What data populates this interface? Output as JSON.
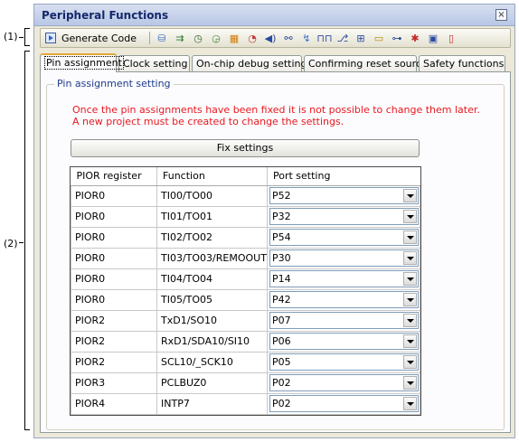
{
  "callouts": {
    "one": "(1)",
    "two": "(2)"
  },
  "window": {
    "title": "Peripheral Functions",
    "close_glyph": "×"
  },
  "toolbar": {
    "generate_label": "Generate Code",
    "icons": [
      {
        "name": "clock-icon",
        "glyph": "⛁",
        "color": "#3a6fc4"
      },
      {
        "name": "port-icon",
        "glyph": "⇉",
        "color": "#2a7a2a"
      },
      {
        "name": "timer-icon",
        "glyph": "◷",
        "color": "#2d6a2d"
      },
      {
        "name": "watchdog-icon",
        "glyph": "◶",
        "color": "#3a8a3a"
      },
      {
        "name": "adc-icon",
        "glyph": "▦",
        "color": "#d07c0c"
      },
      {
        "name": "rtc-icon",
        "glyph": "◔",
        "color": "#c43a3a"
      },
      {
        "name": "sound-icon",
        "glyph": "◀)",
        "color": "#2a4aa0"
      },
      {
        "name": "serial-icon",
        "glyph": "⚯",
        "color": "#2a4aa0"
      },
      {
        "name": "interrupt-icon",
        "glyph": "↯",
        "color": "#3a6fc4"
      },
      {
        "name": "pwm-icon",
        "glyph": "⊓⊓",
        "color": "#2a4aa0"
      },
      {
        "name": "dma-icon",
        "glyph": "⎇",
        "color": "#2a4aa0"
      },
      {
        "name": "mux-icon",
        "glyph": "⊞",
        "color": "#2a4aa0"
      },
      {
        "name": "ram-icon",
        "glyph": "▭",
        "color": "#b88a00"
      },
      {
        "name": "network-icon",
        "glyph": "⊶",
        "color": "#2a4aa0"
      },
      {
        "name": "reset-icon",
        "glyph": "✱",
        "color": "#c42a2a"
      },
      {
        "name": "chip-icon",
        "glyph": "▣",
        "color": "#2a4aa0"
      },
      {
        "name": "battery-icon",
        "glyph": "▯",
        "color": "#c42a2a"
      }
    ]
  },
  "tabs": [
    {
      "label": "Pin assignment",
      "active": true
    },
    {
      "label": "Clock setting",
      "active": false
    },
    {
      "label": "On-chip debug setting",
      "active": false
    },
    {
      "label": "Confirming reset source",
      "active": false
    },
    {
      "label": "Safety functions",
      "active": false
    }
  ],
  "panel": {
    "group_label": "Pin assignment setting",
    "warning_line1": "Once the pin assignments have been fixed it is not possible to change them later.",
    "warning_line2": "A new project must be created to change the settings.",
    "fix_button": "Fix settings"
  },
  "table": {
    "headers": [
      "PIOR register",
      "Function",
      "Port setting"
    ],
    "rows": [
      {
        "register": "PIOR0",
        "function": "TI00/TO00",
        "port": "P52"
      },
      {
        "register": "PIOR0",
        "function": "TI01/TO01",
        "port": "P32"
      },
      {
        "register": "PIOR0",
        "function": "TI02/TO02",
        "port": "P54"
      },
      {
        "register": "PIOR0",
        "function": "TI03/TO03/REMOOUT",
        "port": "P30"
      },
      {
        "register": "PIOR0",
        "function": "TI04/TO04",
        "port": "P14"
      },
      {
        "register": "PIOR0",
        "function": "TI05/TO05",
        "port": "P42"
      },
      {
        "register": "PIOR2",
        "function": "TxD1/SO10",
        "port": "P07"
      },
      {
        "register": "PIOR2",
        "function": "RxD1/SDA10/SI10",
        "port": "P06"
      },
      {
        "register": "PIOR2",
        "function": "SCL10/_SCK10",
        "port": "P05"
      },
      {
        "register": "PIOR3",
        "function": "PCLBUZ0",
        "port": "P02"
      },
      {
        "register": "PIOR4",
        "function": "INTP7",
        "port": "P02"
      }
    ]
  },
  "colors": {
    "warning": "#e8181f",
    "title": "#15286b",
    "group_label": "#1f3b8a",
    "active_tab_accent": "#e2a73b"
  }
}
